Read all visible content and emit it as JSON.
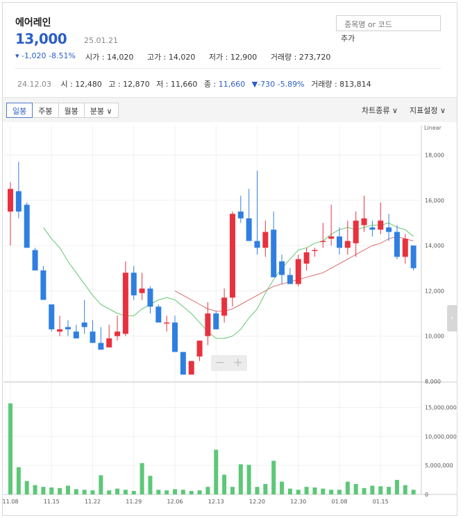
{
  "header": {
    "stock_name": "에어레인",
    "price": "13,000",
    "date": "25.01.21",
    "change": "▾ -1,020  -8.51%",
    "quote": [
      "시가 : 14,020",
      "고가 : 14,020",
      "저가 : 12,900",
      "거래량 : 273,720"
    ]
  },
  "search": {
    "placeholder": "종목명 or 코드",
    "add_label": "추가"
  },
  "prev_day": {
    "date": "24.12.03",
    "open": "시 : 12,480",
    "high": "고 : 12,870",
    "low": "저 : 11,660",
    "close_label": "종 : ",
    "close": "11,660",
    "change": "▼-730  -5.89%",
    "volume": "거래량 : 813,814"
  },
  "toolbar": {
    "tabs": [
      "일봉",
      "주봉",
      "월봉",
      "분봉 ∨"
    ],
    "active_tab": 0,
    "chart_type": "차트종류 ∨",
    "indicator": "지표설정 ∨"
  },
  "controls": {
    "zoom_out": "−",
    "zoom_in": "+",
    "side": "‹"
  },
  "colors": {
    "up": "#e8313f",
    "down": "#2f7fe0",
    "volume": "#5cc878",
    "ma_green": "#63c56f",
    "ma_red": "#dc6a6a",
    "grid": "#f0f0f0"
  },
  "chart_data": [
    {
      "type": "candlestick",
      "scale_label": "Linear",
      "yticks": [
        8000,
        10000,
        12000,
        14000,
        16000,
        18000
      ],
      "ytick_labels": [
        "8,000",
        "10,000",
        "12,000",
        "14,000",
        "16,000",
        "18,000"
      ],
      "ylim": [
        8000,
        19300
      ],
      "candles": [
        {
          "o": 15500,
          "h": 16800,
          "l": 14000,
          "c": 16500
        },
        {
          "o": 16400,
          "h": 17700,
          "l": 15200,
          "c": 15500
        },
        {
          "o": 15800,
          "h": 15900,
          "l": 13900,
          "c": 13900
        },
        {
          "o": 13800,
          "h": 13900,
          "l": 12900,
          "c": 12900
        },
        {
          "o": 12900,
          "h": 13100,
          "l": 11600,
          "c": 11600
        },
        {
          "o": 11400,
          "h": 11400,
          "l": 10200,
          "c": 10300
        },
        {
          "o": 10200,
          "h": 10900,
          "l": 10000,
          "c": 10300
        },
        {
          "o": 10400,
          "h": 10700,
          "l": 10000,
          "c": 10300
        },
        {
          "o": 10200,
          "h": 10500,
          "l": 9900,
          "c": 9900
        },
        {
          "o": 10600,
          "h": 11600,
          "l": 10100,
          "c": 10400
        },
        {
          "o": 10200,
          "h": 10700,
          "l": 9800,
          "c": 9700
        },
        {
          "o": 9700,
          "h": 10400,
          "l": 9700,
          "c": 9400
        },
        {
          "o": 9500,
          "h": 10500,
          "l": 9500,
          "c": 9900
        },
        {
          "o": 10000,
          "h": 10900,
          "l": 9800,
          "c": 10200
        },
        {
          "o": 10100,
          "h": 13300,
          "l": 10000,
          "c": 12800
        },
        {
          "o": 12800,
          "h": 13100,
          "l": 11600,
          "c": 11800
        },
        {
          "o": 11900,
          "h": 12800,
          "l": 11600,
          "c": 12100
        },
        {
          "o": 12100,
          "h": 12200,
          "l": 11000,
          "c": 11300
        },
        {
          "o": 11300,
          "h": 11400,
          "l": 10600,
          "c": 10600
        },
        {
          "o": 10600,
          "h": 10900,
          "l": 10200,
          "c": 10600
        },
        {
          "o": 10600,
          "h": 10900,
          "l": 9300,
          "c": 9300
        },
        {
          "o": 9300,
          "h": 9300,
          "l": 8300,
          "c": 8300
        },
        {
          "o": 8300,
          "h": 8900,
          "l": 8300,
          "c": 8900
        },
        {
          "o": 9100,
          "h": 9800,
          "l": 8900,
          "c": 9800
        },
        {
          "o": 10000,
          "h": 11500,
          "l": 9600,
          "c": 11000
        },
        {
          "o": 11000,
          "h": 11100,
          "l": 10300,
          "c": 10300
        },
        {
          "o": 10900,
          "h": 12100,
          "l": 10600,
          "c": 11700
        },
        {
          "o": 11700,
          "h": 15500,
          "l": 11300,
          "c": 15400
        },
        {
          "o": 15500,
          "h": 16200,
          "l": 15000,
          "c": 15200
        },
        {
          "o": 15200,
          "h": 16500,
          "l": 14200,
          "c": 14200
        },
        {
          "o": 14200,
          "h": 17300,
          "l": 13600,
          "c": 13900
        },
        {
          "o": 13900,
          "h": 15100,
          "l": 13500,
          "c": 14600
        },
        {
          "o": 14700,
          "h": 15500,
          "l": 12600,
          "c": 12600
        },
        {
          "o": 13300,
          "h": 13600,
          "l": 12300,
          "c": 12700
        },
        {
          "o": 12700,
          "h": 13000,
          "l": 12300,
          "c": 12300
        },
        {
          "o": 12300,
          "h": 13600,
          "l": 12200,
          "c": 13400
        },
        {
          "o": 13200,
          "h": 13900,
          "l": 12900,
          "c": 13700
        },
        {
          "o": 13800,
          "h": 13900,
          "l": 13500,
          "c": 13800
        },
        {
          "o": 14200,
          "h": 15000,
          "l": 13900,
          "c": 14200
        },
        {
          "o": 14300,
          "h": 15800,
          "l": 14000,
          "c": 14400
        },
        {
          "o": 14400,
          "h": 14800,
          "l": 13600,
          "c": 13900
        },
        {
          "o": 13900,
          "h": 15100,
          "l": 13600,
          "c": 14200
        },
        {
          "o": 14100,
          "h": 15500,
          "l": 13500,
          "c": 15100
        },
        {
          "o": 14900,
          "h": 16200,
          "l": 14600,
          "c": 15200
        },
        {
          "o": 14800,
          "h": 15100,
          "l": 14400,
          "c": 14700
        },
        {
          "o": 14700,
          "h": 15900,
          "l": 14500,
          "c": 15100
        },
        {
          "o": 14800,
          "h": 15400,
          "l": 14200,
          "c": 14600
        },
        {
          "o": 14600,
          "h": 14900,
          "l": 13400,
          "c": 13500
        },
        {
          "o": 13500,
          "h": 14500,
          "l": 13200,
          "c": 14300
        },
        {
          "o": 14000,
          "h": 14000,
          "l": 12900,
          "c": 13000
        }
      ],
      "ma_green": [
        null,
        null,
        null,
        null,
        14800,
        14300,
        13900,
        13300,
        12800,
        12300,
        11800,
        11400,
        11200,
        11000,
        10900,
        10900,
        11200,
        11400,
        11600,
        11700,
        11600,
        11300,
        11000,
        10600,
        10200,
        9900,
        9900,
        10000,
        10300,
        10800,
        11200,
        11900,
        12500,
        13000,
        13400,
        13800,
        13900,
        14100,
        14200,
        14500,
        14700,
        14800,
        14700,
        14800,
        14900,
        14900,
        15000,
        14800,
        14700,
        14400
      ],
      "ma_red": [
        null,
        null,
        null,
        null,
        null,
        null,
        null,
        null,
        null,
        null,
        null,
        null,
        null,
        null,
        null,
        null,
        null,
        null,
        null,
        null,
        12000,
        11800,
        11600,
        11400,
        11200,
        11100,
        11100,
        11200,
        11400,
        11600,
        11800,
        12000,
        12200,
        12300,
        12400,
        12500,
        12600,
        12700,
        12800,
        13000,
        13200,
        13400,
        13600,
        13800,
        14000,
        14100,
        14300,
        14400,
        14300,
        14200
      ]
    },
    {
      "type": "bar",
      "series_kind": "volume",
      "yticks": [
        0,
        5000000,
        10000000,
        15000000
      ],
      "ytick_labels": [
        "0",
        "5,000,000",
        "10,000,000",
        "15,000,000"
      ],
      "ylim": [
        0,
        19000000
      ],
      "values": [
        15700000,
        4700000,
        2300000,
        1600000,
        1300000,
        1200000,
        1100000,
        1500000,
        900000,
        800000,
        700000,
        3300000,
        700000,
        1000000,
        800000,
        600000,
        5400000,
        3200000,
        800000,
        700000,
        900000,
        800000,
        600000,
        700000,
        1300000,
        7700000,
        3400000,
        1300000,
        5200000,
        5100000,
        1300000,
        1800000,
        5800000,
        2200000,
        1000000,
        800000,
        1300000,
        1200000,
        1000000,
        800000,
        800000,
        2200000,
        1800000,
        1100000,
        1500000,
        1400000,
        1300000,
        2500000,
        1600000,
        800000
      ],
      "xticks": [
        {
          "i": 0,
          "label": "11.08"
        },
        {
          "i": 5,
          "label": "11.15"
        },
        {
          "i": 10,
          "label": "11.22"
        },
        {
          "i": 15,
          "label": "11.29"
        },
        {
          "i": 20,
          "label": "12.06"
        },
        {
          "i": 25,
          "label": "12.13"
        },
        {
          "i": 30,
          "label": "12.20"
        },
        {
          "i": 35,
          "label": "12.30"
        },
        {
          "i": 40,
          "label": "01.08"
        },
        {
          "i": 45,
          "label": "01.15"
        }
      ]
    }
  ]
}
